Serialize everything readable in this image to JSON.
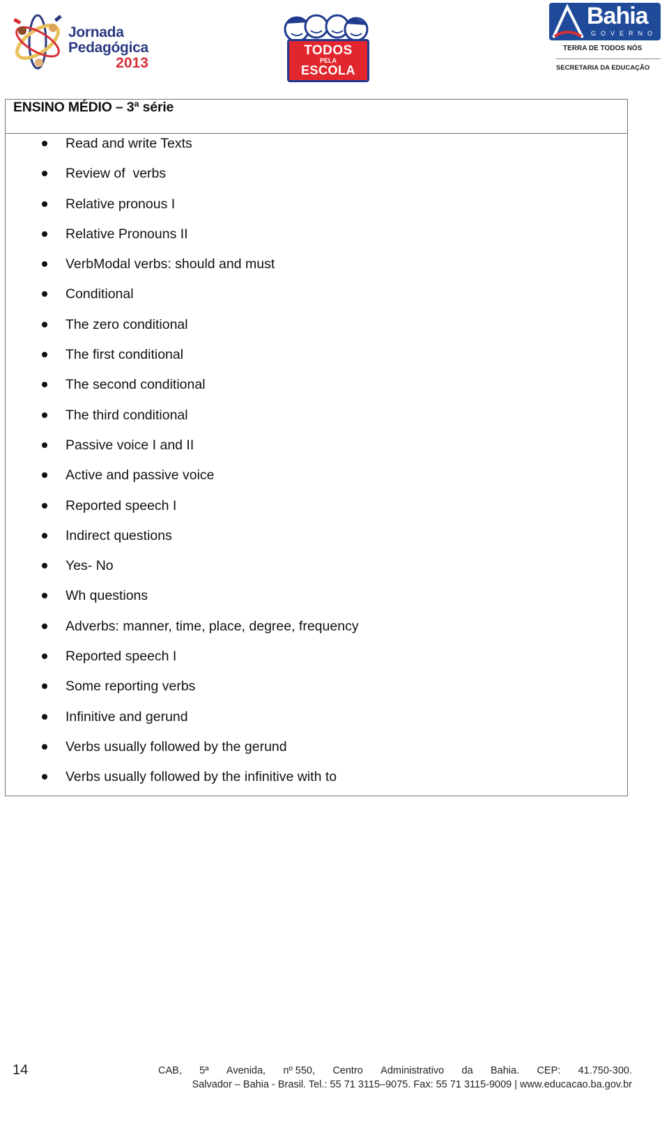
{
  "header": {
    "logos": {
      "jornada": {
        "line1": "Jornada",
        "line2": "Pedagógica",
        "year": "2013"
      },
      "todos": {
        "line1": "TODOS",
        "line2": "PELA",
        "line3": "ESCOLA"
      },
      "bahia": {
        "name": "Bahia",
        "governo": "GOVERNO",
        "tagline": "TERRA DE TODOS NÓS",
        "secretaria": "SECRETARIA DA EDUCAÇÃO"
      }
    },
    "colors": {
      "navy": "#2b3a82",
      "red": "#d62e36",
      "bahia_blue": "#1f4a9a",
      "table_border": "#6b7585"
    }
  },
  "table": {
    "title": "ENSINO MÉDIO – 3ª série",
    "topics": [
      "Read and write Texts",
      "Review of  verbs",
      "Relative pronous I",
      "Relative Pronouns II",
      "VerbModal verbs: should and must",
      "Conditional",
      "The zero conditional",
      "The first conditional",
      "The second conditional",
      "The third conditional",
      "Passive voice I and II",
      "Active and passive voice",
      "Reported speech I",
      "Indirect questions",
      "Yes- No",
      "Wh questions",
      "Adverbs: manner, time, place, degree, frequency",
      "Reported speech I",
      "Some reporting verbs",
      "Infinitive and gerund",
      "Verbs usually followed by the gerund",
      "Verbs usually followed by the infinitive with to"
    ]
  },
  "footer": {
    "page_number": "14",
    "address_parts": [
      "CAB,",
      "5ª",
      "Avenida,",
      "nº 550,",
      "Centro",
      "Administrativo",
      "da",
      "Bahia.",
      "CEP:",
      "41.750-300."
    ],
    "line2": "Salvador – Bahia - Brasil. Tel.: 55 71 3115–9075. Fax: 55 71 3115-9009 | www.educacao.ba.gov.br"
  }
}
